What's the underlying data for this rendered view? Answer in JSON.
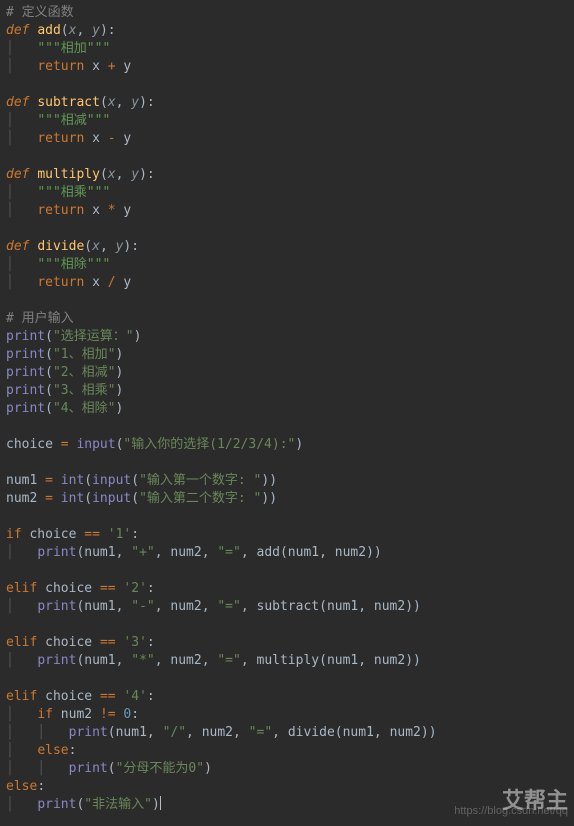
{
  "code": {
    "comment_def": "# 定义函数",
    "def": "def",
    "add_name": "add",
    "sub_name": "subtract",
    "mul_name": "multiply",
    "div_name": "divide",
    "px": "x",
    "py": "y",
    "doc_add": "\"\"\"相加\"\"\"",
    "doc_sub": "\"\"\"相减\"\"\"",
    "doc_mul": "\"\"\"相乘\"\"\"",
    "doc_div": "\"\"\"相除\"\"\"",
    "ret": "return",
    "comment_input": "# 用户输入",
    "print": "print",
    "input": "input",
    "int": "int",
    "s_select": "\"选择运算：\"",
    "s_opt1": "\"1、相加\"",
    "s_opt2": "\"2、相减\"",
    "s_opt3": "\"3、相乘\"",
    "s_opt4": "\"4、相除\"",
    "s_prompt": "\"输入你的选择(1/2/3/4):\"",
    "s_num1": "\"输入第一个数字: \"",
    "s_num2": "\"输入第二个数字: \"",
    "choice": "choice",
    "num1": "num1",
    "num2": "num2",
    "if": "if",
    "elif": "elif",
    "else": "else",
    "eqeq": "==",
    "ne": "!=",
    "q1": "'1'",
    "q2": "'2'",
    "q3": "'3'",
    "q4": "'4'",
    "zero": "0",
    "qplus": "\"+\"",
    "qminus": "\"-\"",
    "qstar": "\"*\"",
    "qslash": "\"/\"",
    "qeq": "\"=\"",
    "s_divzero": "\"分母不能为0\"",
    "s_illegal": "\"非法输入\""
  },
  "watermark_small": "https://blog.csdn.net/qq",
  "watermark_big": "艾帮主"
}
